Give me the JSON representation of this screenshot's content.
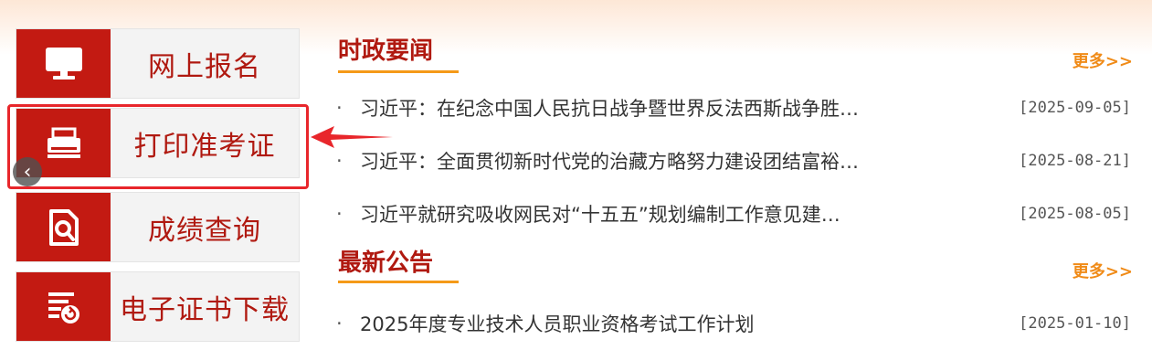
{
  "nav": {
    "items": [
      {
        "label": "网上报名",
        "icon": "monitor-icon"
      },
      {
        "label": "打印准考证",
        "icon": "printer-icon"
      },
      {
        "label": "成绩查询",
        "icon": "document-search-icon"
      },
      {
        "label": "电子证书下载",
        "icon": "certificate-download-icon"
      }
    ],
    "prev_glyph": "‹"
  },
  "news": {
    "title": "时政要闻",
    "more": "更多>>",
    "items": [
      {
        "bullet": "·",
        "text": "习近平：在纪念中国人民抗日战争暨世界反法西斯战争胜…",
        "date": "[2025-09-05]"
      },
      {
        "bullet": "·",
        "text": "习近平：全面贯彻新时代党的治藏方略努力建设团结富裕…",
        "date": "[2025-08-21]"
      },
      {
        "bullet": "·",
        "text": "习近平就研究吸收网民对“十五五”规划编制工作意见建…",
        "date": "[2025-08-05]"
      }
    ]
  },
  "notices": {
    "title": "最新公告",
    "more": "更多>>",
    "items": [
      {
        "bullet": "·",
        "text": "2025年度专业技术人员职业资格考试工作计划",
        "date": "[2025-01-10]"
      }
    ]
  },
  "colors": {
    "brand_red": "#c31a12",
    "accent_orange": "#f59a18",
    "highlight_red": "#e8262b"
  }
}
